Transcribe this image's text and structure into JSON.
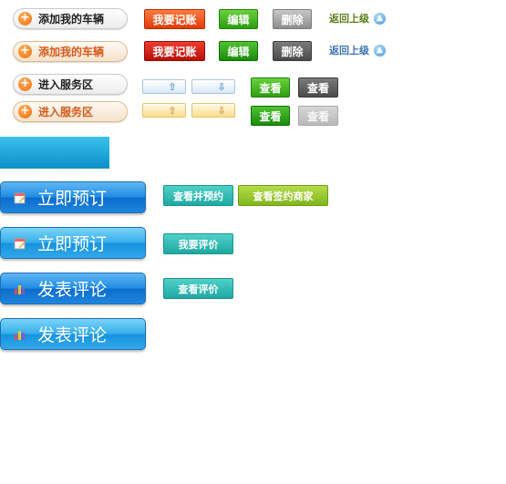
{
  "pill_buttons": {
    "add_car": "添加我的车辆",
    "add_car_hover": "添加我的车辆",
    "enter_service": "进入服务区",
    "enter_service_hover": "进入服务区"
  },
  "row1": {
    "record": "我要记账",
    "edit": "编辑",
    "delete": "删除",
    "back": "返回上级"
  },
  "row2": {
    "record": "我要记账",
    "edit": "编辑",
    "delete": "删除",
    "back": "返回上级"
  },
  "view_buttons": {
    "view_green": "查看",
    "view_gray": "查看",
    "view_green_pressed": "查看",
    "view_disabled": "查看"
  },
  "arrows": {
    "up": "⇧",
    "down": "⇩"
  },
  "big_buttons": {
    "book_now_1": "立即预订",
    "book_now_2": "立即预订",
    "comment_1": "发表评论",
    "comment_2": "发表评论"
  },
  "small_buttons": {
    "view_and_book": "查看并预约",
    "view_merchants": "查看签约商家",
    "my_review": "我要评价",
    "view_reviews": "查看评价"
  },
  "colors": {
    "accent_orange": "#f26a0a",
    "teal": "#1ea9a2",
    "blue": "#1f8be3",
    "bar": "#1aa7da"
  }
}
